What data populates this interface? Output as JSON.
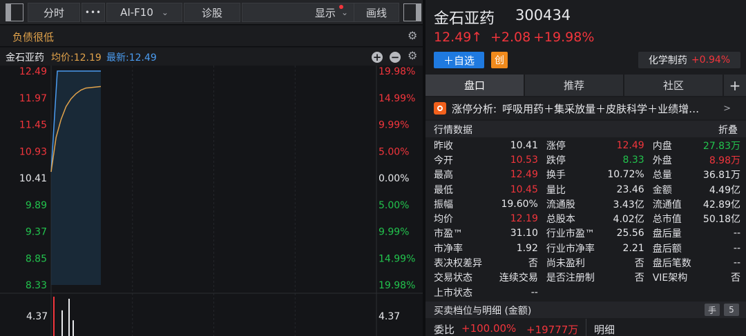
{
  "toolbar": {
    "tab_timeshare": "分时",
    "more": "•••",
    "f10": "AI-F10",
    "diagnose": "诊股",
    "display": "显示",
    "draw": "画线"
  },
  "subbar": {
    "tag": "负债很低"
  },
  "chart_header": {
    "name": "金石亚药",
    "avg_label": "均价:12.19",
    "latest_label": "最新:12.49"
  },
  "chart_data": {
    "type": "line",
    "price_ticks": [
      "12.49",
      "11.97",
      "11.45",
      "10.93",
      "10.41",
      "9.89",
      "9.37",
      "8.85",
      "8.33"
    ],
    "pct_ticks": [
      "19.98%",
      "14.99%",
      "9.99%",
      "5.00%",
      "0.00%",
      "5.00%",
      "9.99%",
      "14.99%",
      "19.98%"
    ],
    "volume_tick_left": "4.37",
    "volume_tick_right": "4.37",
    "prev_close": 10.41,
    "ylim": [
      8.33,
      12.49
    ],
    "series": [
      {
        "values": [
          10.53,
          12.49,
          12.49,
          12.49,
          12.49,
          12.49,
          12.49,
          12.49,
          12.49
        ]
      },
      {
        "values": [
          10.53,
          11.2,
          11.55,
          11.8,
          11.95,
          12.05,
          12.12,
          12.16,
          12.17,
          12.18,
          12.19
        ]
      }
    ],
    "colors": {
      "price": "#4b9cf0",
      "avg": "#e2a34b",
      "up": "#f2353c",
      "down": "#22c34d"
    }
  },
  "stock": {
    "name": "金石亚药",
    "code": "300434",
    "price": "12.49↑",
    "change": "+2.08",
    "change_pct": "+19.98%",
    "add_watch": "＋自选",
    "create": "创",
    "industry": "化学制药",
    "industry_change": "+0.94%"
  },
  "tabs": [
    "盘口",
    "推荐",
    "社区"
  ],
  "plus": "+",
  "limit_analysis": {
    "label": "涨停分析:",
    "text": "呼吸用药＋集采放量＋皮肤科学＋业绩增…",
    "chevron": ">"
  },
  "quote_header": {
    "title": "行情数据",
    "fold": "折叠"
  },
  "quote_rows": [
    [
      [
        "昨收",
        "10.41"
      ],
      [
        "涨停",
        "12.49"
      ],
      [
        "内盘",
        "27.83万"
      ]
    ],
    [
      [
        "今开",
        "10.53"
      ],
      [
        "跌停",
        "8.33"
      ],
      [
        "外盘",
        "8.98万"
      ]
    ],
    [
      [
        "最高",
        "12.49"
      ],
      [
        "换手",
        "10.72%"
      ],
      [
        "总量",
        "36.81万"
      ]
    ],
    [
      [
        "最低",
        "10.45"
      ],
      [
        "量比",
        "23.46"
      ],
      [
        "金额",
        "4.49亿"
      ]
    ],
    [
      [
        "振幅",
        "19.60%"
      ],
      [
        "流通股",
        "3.43亿"
      ],
      [
        "流通值",
        "42.89亿"
      ]
    ],
    [
      [
        "均价",
        "12.19"
      ],
      [
        "总股本",
        "4.02亿"
      ],
      [
        "总市值",
        "50.18亿"
      ]
    ],
    [
      [
        "市盈™",
        "31.10"
      ],
      [
        "行业市盈™",
        "25.56"
      ],
      [
        "盘后量",
        "--"
      ]
    ],
    [
      [
        "市净率",
        "1.92"
      ],
      [
        "行业市净率",
        "2.21"
      ],
      [
        "盘后额",
        "--"
      ]
    ],
    [
      [
        "表决权差异",
        "否"
      ],
      [
        "尚未盈利",
        "否"
      ],
      [
        "盘后笔数",
        "--"
      ]
    ],
    [
      [
        "交易状态",
        "连续交易"
      ],
      [
        "是否注册制",
        "否"
      ],
      [
        "VIE架构",
        "否"
      ]
    ],
    [
      [
        "上市状态",
        "--"
      ],
      [
        "",
        ""
      ],
      [
        "",
        ""
      ]
    ]
  ],
  "quote_colors": [
    [
      "white",
      "red",
      "green"
    ],
    [
      "red",
      "green",
      "red"
    ],
    [
      "red",
      "white",
      "white"
    ],
    [
      "red",
      "white",
      "white"
    ],
    [
      "white",
      "white",
      "white"
    ],
    [
      "red",
      "white",
      "white"
    ],
    [
      "white",
      "white",
      "white"
    ],
    [
      "white",
      "white",
      "white"
    ],
    [
      "white",
      "white",
      "white"
    ],
    [
      "white",
      "white",
      "white"
    ],
    [
      "white",
      "white",
      "white"
    ]
  ],
  "order_book": {
    "title": "买卖档位与明细 (金额)",
    "hand": "手",
    "level": "5",
    "ratio_label": "委比",
    "ratio_value": "+100.00%",
    "ratio_amount": "+19777万",
    "detail": "明细"
  }
}
